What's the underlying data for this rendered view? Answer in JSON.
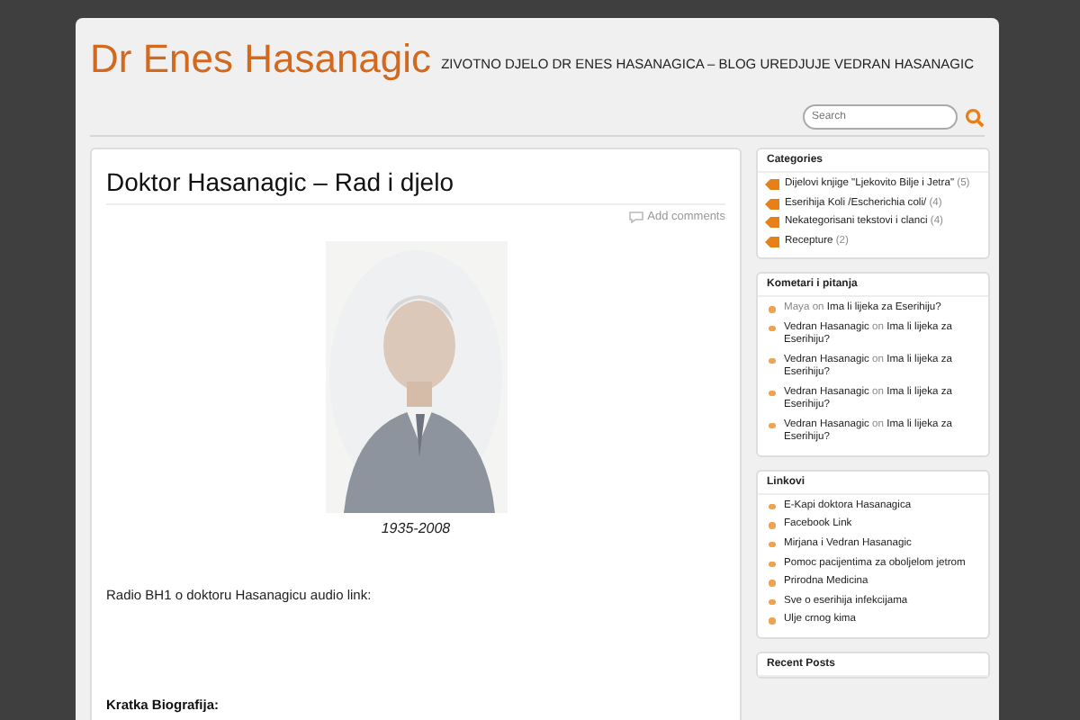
{
  "site": {
    "title": "Dr Enes Hasanagic",
    "tagline": "ZIVOTNO DJELO DR ENES HASANAGICA – BLOG UREDJUJE VEDRAN HASANAGIC"
  },
  "search": {
    "placeholder": "Search"
  },
  "post": {
    "title": "Doktor Hasanagic – Rad i djelo",
    "comments_link": "Add comments",
    "caption": "1935-2008",
    "paragraphs": [
      {
        "kind": "plain",
        "text": "Radio BH1 o doktoru Hasanagicu audio link:"
      },
      {
        "kind": "heading",
        "text": "Kratka Biografija:"
      }
    ]
  },
  "sidebar": {
    "widgets": [
      {
        "kind": "categories",
        "title": "Categories",
        "items": [
          {
            "label": "Dijelovi knjige \"Ljekovito Bilje i Jetra\"",
            "count": "(5)"
          },
          {
            "label": "Eserihija Koli /Escherichia coli/",
            "count": "(4)"
          },
          {
            "label": "Nekategorisani tekstovi i clanci",
            "count": "(4)"
          },
          {
            "label": "Recepture",
            "count": "(2)"
          }
        ]
      },
      {
        "kind": "comments",
        "title": "Kometari i pitanja",
        "items": [
          {
            "author": "Maya",
            "author_link": false,
            "on": "on",
            "post": "Ima li lijeka za Eserihiju?"
          },
          {
            "author": "Vedran Hasanagic",
            "author_link": true,
            "on": "on",
            "post": "Ima li lijeka za Eserihiju?"
          },
          {
            "author": "Vedran Hasanagic",
            "author_link": true,
            "on": "on",
            "post": "Ima li lijeka za Eserihiju?"
          },
          {
            "author": "Vedran Hasanagic",
            "author_link": true,
            "on": "on",
            "post": "Ima li lijeka za Eserihiju?"
          },
          {
            "author": "Vedran Hasanagic",
            "author_link": true,
            "on": "on",
            "post": "Ima li lijeka za Eserihiju?"
          }
        ]
      },
      {
        "kind": "links",
        "title": "Linkovi",
        "items": [
          {
            "label": "E-Kapi doktora Hasanagica"
          },
          {
            "label": "Facebook Link"
          },
          {
            "label": "Mirjana i Vedran Hasanagic"
          },
          {
            "label": "Pomoc pacijentima za oboljelom jetrom"
          },
          {
            "label": "Prirodna Medicina"
          },
          {
            "label": "Sve o eserihija infekcijama"
          },
          {
            "label": "Ulje crnog kima"
          }
        ]
      },
      {
        "kind": "links",
        "title": "Recent Posts"
      }
    ]
  }
}
